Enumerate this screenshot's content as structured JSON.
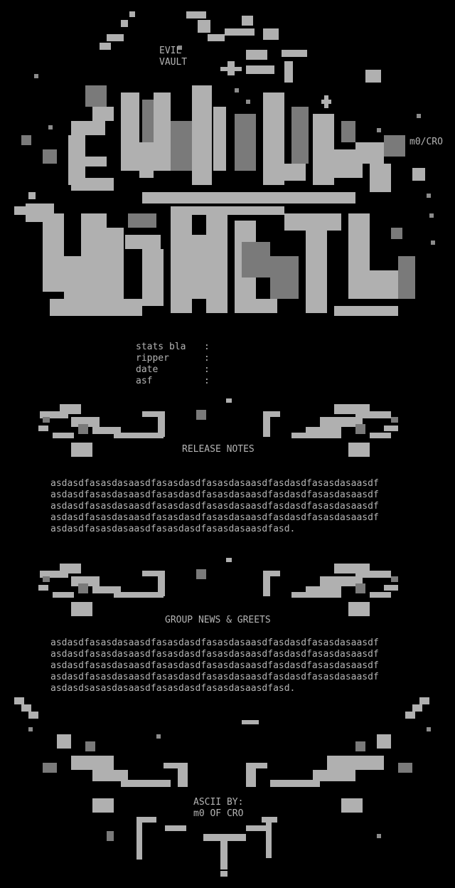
{
  "logo": {
    "title_line1": "EVIL",
    "title_line2": "VAULT",
    "signature": "m0/CRO"
  },
  "stats": {
    "rows": [
      {
        "label": "stats bla",
        "sep": ":"
      },
      {
        "label": "ripper",
        "sep": ":"
      },
      {
        "label": "date",
        "sep": ":"
      },
      {
        "label": "asf",
        "sep": ":"
      }
    ]
  },
  "sections": [
    {
      "title": "RELEASE NOTES",
      "lines": [
        "asdasdfasasdasaasdfasasdasdfasasdasaasdfasdasdfasasdasaasdf",
        "asdasdfasasdasaasdfasasdasdfasasdasaasdfasdasdfasasdasaasdf",
        "asdasdfasasdasaasdfasasdasdfasasdasaasdfasdasdfasasdasaasdf",
        "asdasdfasasdasaasdfasasdasdfasasdasaasdfasdasdfasasdasaasdf",
        "asdasdfasasdasaasdfasasdasdfasasdasaasdfasd."
      ]
    },
    {
      "title": "GROUP NEWS & GREETS",
      "lines": [
        "asdasdfasasdasaasdfasasdasdfasasdasaasdfasdasdfasasdasaasdf",
        "asdasdfasasdasaasdfasasdasdfasasdasaasdfasdasdfasasdasaasdf",
        "asdasdfasasdasaasdfasasdasdfasasdasaasdfasdasdfasasdasaasdf",
        "asdasdfasasdasaasdfasasdasdfasasdasaasdfasdasdfasasdasaasdf",
        "asdasdsasasdasaasdfasasdasdfasasdasaasdfasd."
      ]
    }
  ],
  "footer": {
    "credit_line1": "ASCII BY:",
    "credit_line2": "m0 OF CRO"
  },
  "colors": {
    "background": "#000000",
    "text": "#b4b4b4",
    "art_light": "#b0b0b0",
    "art_dark": "#7a7a7a"
  }
}
